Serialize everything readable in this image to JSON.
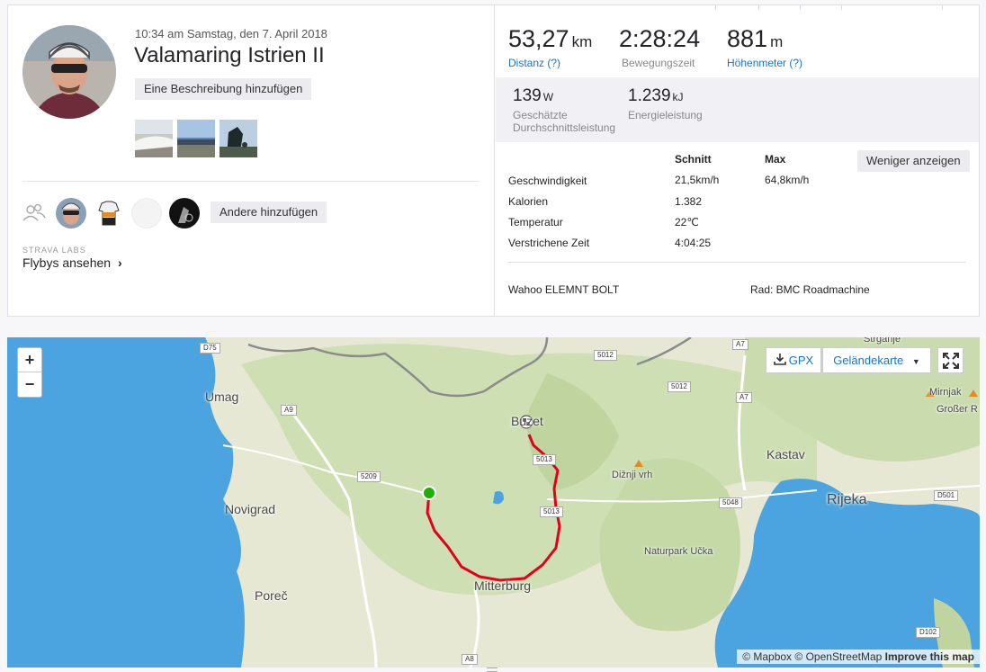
{
  "activity": {
    "datetime": "10:34 am Samstag, den 7. April 2018",
    "title": "Valamaring Istrien II",
    "add_description_label": "Eine Beschreibung hinzufügen",
    "add_others_label": "Andere hinzufügen",
    "labs_label": "STRAVA LABS",
    "flybys_label": "Flybys ansehen",
    "chevron_glyph": "›"
  },
  "stats": {
    "distance": {
      "value": "53,27",
      "unit": "km",
      "label": "Distanz (?)"
    },
    "moving_time": {
      "value": "2:28:24",
      "label": "Bewegungszeit"
    },
    "elevation": {
      "value": "881",
      "unit": "m",
      "label": "Höhenmeter (?)"
    },
    "power": {
      "value": "139",
      "unit": "W",
      "label_line1": "Geschätzte",
      "label_line2": "Durchschnittsleistung"
    },
    "energy": {
      "value": "1.239",
      "unit": "kJ",
      "label": "Energieleistung"
    }
  },
  "details": {
    "col_avg": "Schnitt",
    "col_max": "Max",
    "less_button": "Weniger anzeigen",
    "rows": [
      {
        "label": "Geschwindigkeit",
        "avg": "21,5km/h",
        "max": "64,8km/h"
      },
      {
        "label": "Kalorien",
        "avg": "1.382",
        "max": ""
      },
      {
        "label": "Temperatur",
        "avg": "22℃",
        "max": ""
      },
      {
        "label": "Verstrichene Zeit",
        "avg": "4:04:25",
        "max": ""
      }
    ],
    "device": "Wahoo ELEMNT BOLT",
    "bike": "Rad: BMC Roadmachine"
  },
  "map": {
    "zoom_in": "+",
    "zoom_out": "−",
    "gpx_label": "GPX",
    "map_type_label": "Geländekarte",
    "attribution_1": "© Mapbox",
    "attribution_2": "© OpenStreetMap",
    "attribution_3": "Improve this map",
    "places": {
      "umag": "Umag",
      "novigrad": "Novigrad",
      "porec": "Poreč",
      "mitterburg": "Mitterburg",
      "buzet": "Buzet",
      "kastav": "Kastav",
      "rijeka": "Rijeka",
      "dizni": "Dižnji vrh",
      "ucka": "Naturpark Učka",
      "mirnjak": "Mirnjak",
      "grosser": "Großer R",
      "strganje": "Strganje"
    },
    "roads": {
      "d75": "D75",
      "a9": "A9",
      "r5209": "5209",
      "r5012a": "5012",
      "r5012b": "5012",
      "a7a": "A7",
      "a7b": "A7",
      "r5013a": "5013",
      "r5013b": "5013",
      "r5048": "5048",
      "d501": "D501",
      "d102": "D102",
      "a8": "A8"
    },
    "colors": {
      "sea": "#4aa3df",
      "land": "#e8e9d8",
      "forest": "#c9dcb0",
      "route": "#e3001b",
      "start": "#1db000",
      "border": "#8b8b8b"
    }
  }
}
